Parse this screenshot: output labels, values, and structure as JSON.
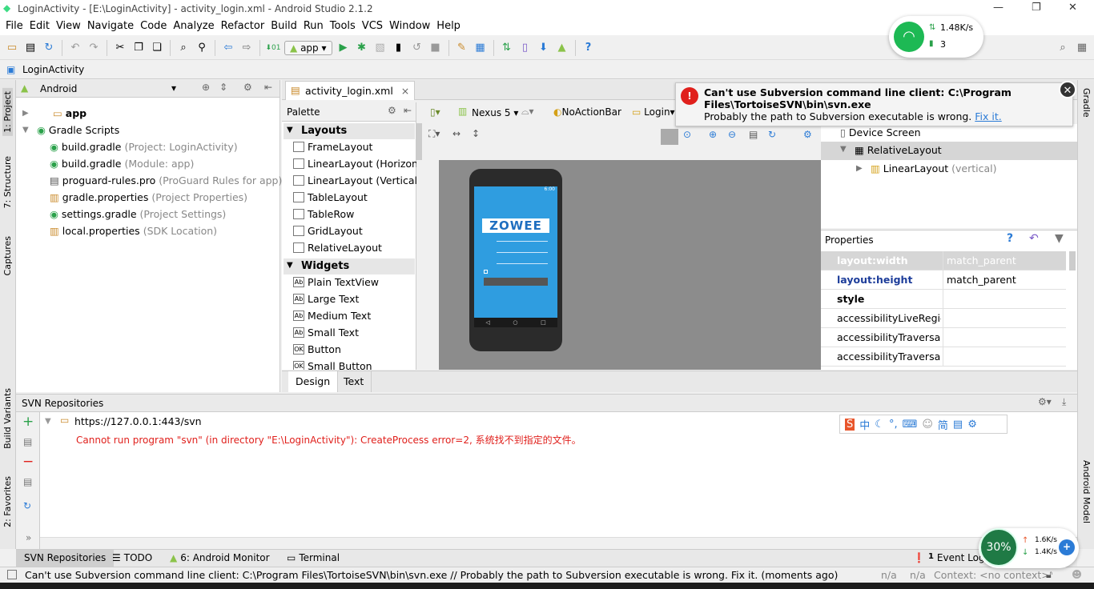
{
  "window": {
    "title": "LoginActivity - [E:\\LoginActivity] - activity_login.xml - Android Studio 2.1.2",
    "minimize": "—",
    "restore": "❐",
    "close": "✕"
  },
  "menu": [
    "File",
    "Edit",
    "View",
    "Navigate",
    "Code",
    "Analyze",
    "Refactor",
    "Build",
    "Run",
    "Tools",
    "VCS",
    "Window",
    "Help"
  ],
  "toolbar": {
    "run_config": "app"
  },
  "breadcrumb": {
    "item": "LoginActivity"
  },
  "left_stripe": {
    "project": "1: Project",
    "structure": "7: Structure",
    "captures": "Captures",
    "build_variants": "Build Variants",
    "favorites": "2: Favorites"
  },
  "right_stripe": {
    "gradle": "Gradle",
    "android_model": "Android Model"
  },
  "project": {
    "view_selector": "Android",
    "items": [
      {
        "name": "app",
        "hint": ""
      },
      {
        "name": "Gradle Scripts",
        "hint": ""
      },
      {
        "name": "build.gradle",
        "hint": "(Project: LoginActivity)"
      },
      {
        "name": "build.gradle",
        "hint": "(Module: app)"
      },
      {
        "name": "proguard-rules.pro",
        "hint": "(ProGuard Rules for app)"
      },
      {
        "name": "gradle.properties",
        "hint": "(Project Properties)"
      },
      {
        "name": "settings.gradle",
        "hint": "(Project Settings)"
      },
      {
        "name": "local.properties",
        "hint": "(SDK Location)"
      }
    ]
  },
  "editor": {
    "tab": "activity_login.xml"
  },
  "palette": {
    "title": "Palette",
    "categories": [
      "Layouts",
      "Widgets"
    ],
    "layouts": [
      "FrameLayout",
      "LinearLayout (Horizontal)",
      "LinearLayout (Vertical)",
      "TableLayout",
      "TableRow",
      "GridLayout",
      "RelativeLayout"
    ],
    "widgets": [
      "Plain TextView",
      "Large Text",
      "Medium Text",
      "Small Text",
      "Button",
      "Small Button"
    ],
    "widget_icons": [
      "Ab",
      "Ab",
      "Ab",
      "Ab",
      "OK",
      "OK"
    ]
  },
  "design_toolbar": {
    "device": "Nexus 5",
    "theme": "NoActionBar",
    "activity": "Login"
  },
  "phone": {
    "logo": "ZOWEE",
    "status_time": "6:00"
  },
  "component_tree": {
    "root": "Device Screen",
    "child": "RelativeLayout",
    "grandchild": "LinearLayout",
    "grandchild_hint": "(vertical)"
  },
  "properties": {
    "title": "Properties",
    "rows": [
      {
        "key": "layout:width",
        "value": "match_parent"
      },
      {
        "key": "layout:height",
        "value": "match_parent"
      },
      {
        "key": "style",
        "value": ""
      },
      {
        "key": "accessibilityLiveRegion",
        "value": ""
      },
      {
        "key": "accessibilityTraversalAfter",
        "value": ""
      },
      {
        "key": "accessibilityTraversalBefore",
        "value": ""
      }
    ]
  },
  "design_tabs": [
    "Design",
    "Text"
  ],
  "notification": {
    "title": "Can't use Subversion command line client: C:\\Program Files\\TortoiseSVN\\bin\\svn.exe",
    "body": "Probably the path to Subversion executable is wrong.",
    "link": "Fix it."
  },
  "svn": {
    "title": "SVN Repositories",
    "repo": "https://127.0.0.1:443/svn",
    "error": "Cannot run program \"svn\" (in directory \"E:\\LoginActivity\"): CreateProcess error=2, 系统找不到指定的文件。"
  },
  "bottom_tabs": [
    "SVN Repositories",
    "TODO",
    "6: Android Monitor",
    "Terminal"
  ],
  "event_log": {
    "count": "1",
    "label": "Event Log"
  },
  "status": {
    "message": "Can't use Subversion command line client: C:\\Program Files\\TortoiseSVN\\bin\\svn.exe // Probably the path to Subversion executable is wrong. Fix it. (moments ago)",
    "pos1": "n/a",
    "pos2": "n/a",
    "context": "Context: <no context>"
  },
  "wifi_widget": {
    "speed": "1.48K/s",
    "devices": "3"
  },
  "ime": [
    "中",
    "简"
  ],
  "speed_widget": {
    "percent": "30%",
    "up": "1.6K/s",
    "down": "1.4K/s"
  },
  "colors": {
    "accent": "#2b7bd6",
    "error": "#e0201c",
    "run": "#2aa14a",
    "selected_row": "#d6d6d6"
  }
}
